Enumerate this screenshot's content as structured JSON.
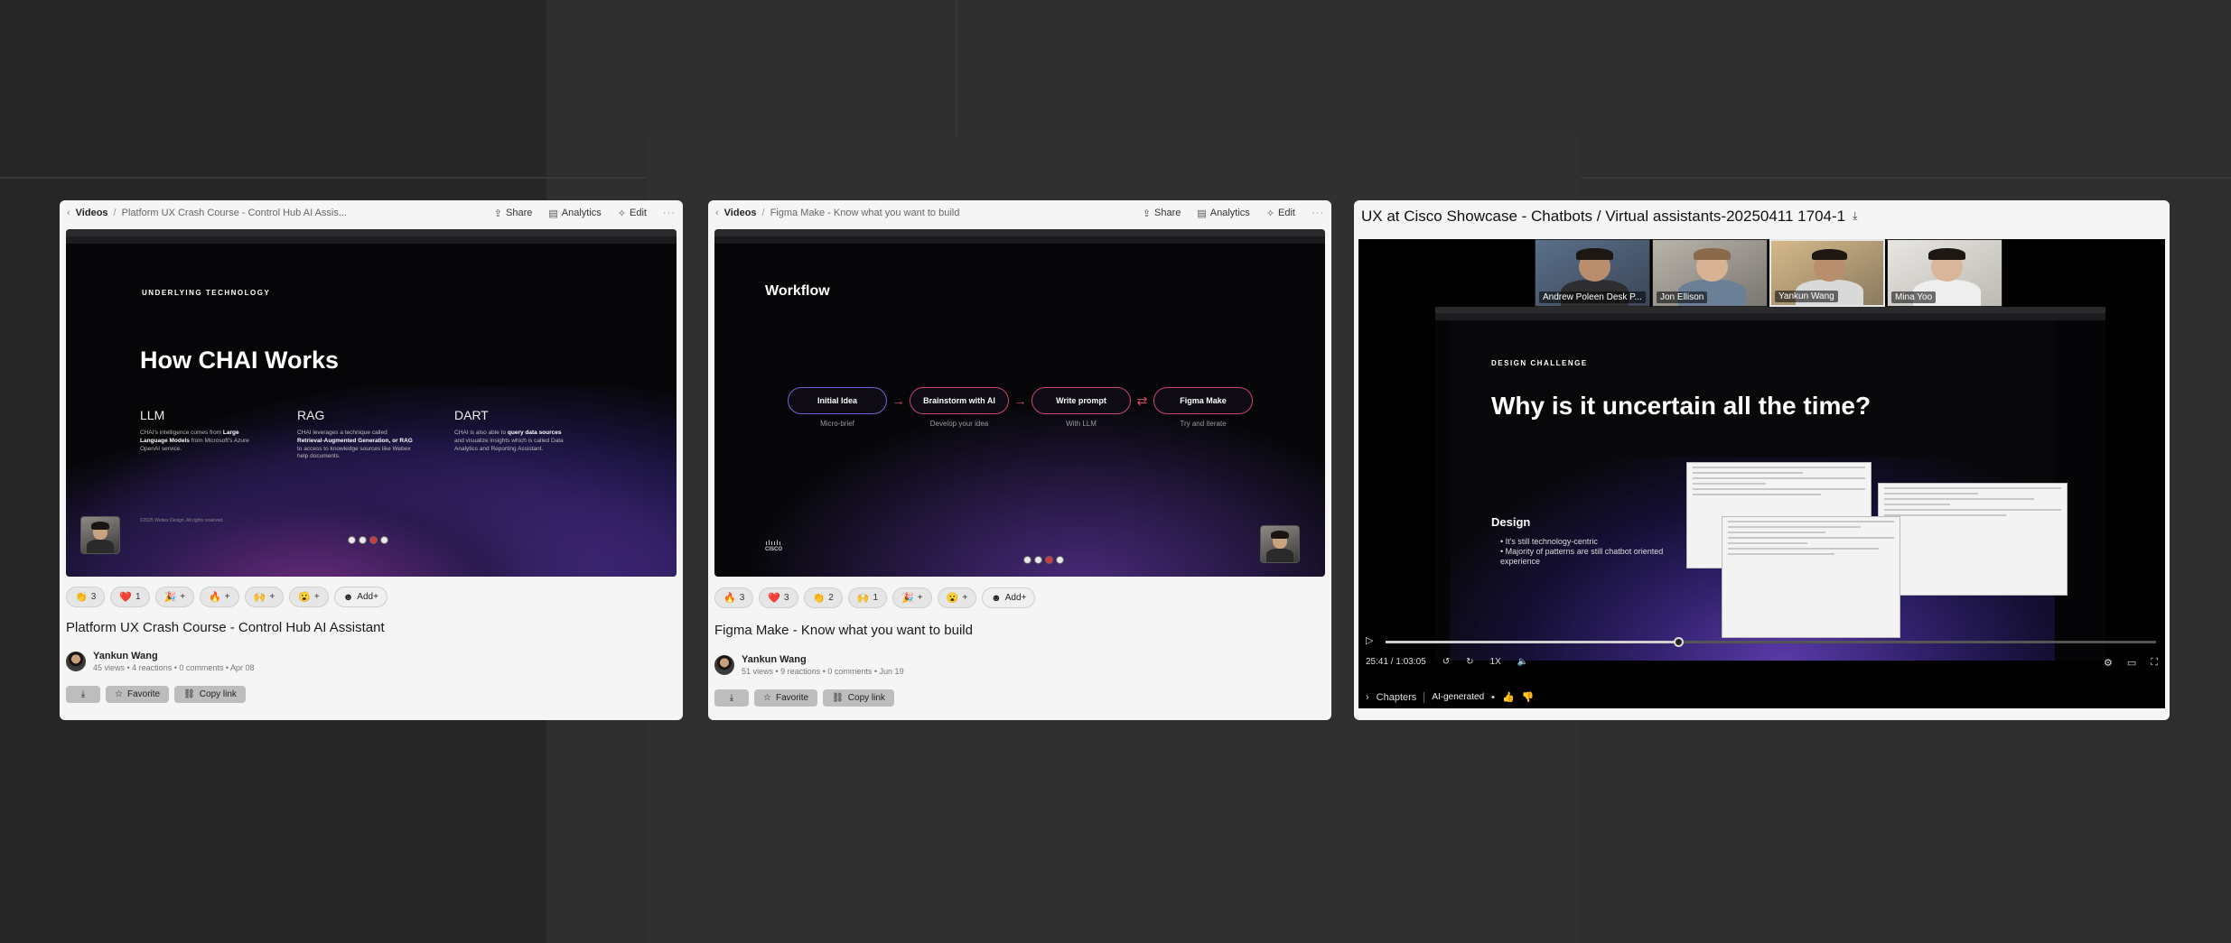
{
  "panels": [
    {
      "breadcrumb_root": "Videos",
      "breadcrumb_sep": "/",
      "breadcrumb_title": "Platform UX Crash Course - Control Hub AI Assis...",
      "share_label": "Share",
      "analytics_label": "Analytics",
      "edit_label": "Edit",
      "more": "···",
      "slide": {
        "kicker": "UNDERLYING TECHNOLOGY",
        "title": "How CHAI Works",
        "copyright": "©2025 Webex Design. All rights reserved."
      },
      "reactions": [
        {
          "emoji": "👏",
          "count": "3"
        },
        {
          "emoji": "❤️",
          "count": "1"
        },
        {
          "emoji": "🎉",
          "count": "+"
        },
        {
          "emoji": "🔥",
          "count": "+"
        },
        {
          "emoji": "🙌",
          "count": "+"
        },
        {
          "emoji": "😮",
          "count": "+"
        }
      ],
      "add_reaction_label": "Add+",
      "title": "Platform UX Crash Course - Control Hub AI Assistant",
      "author_name": "Yankun Wang",
      "views": "45 views",
      "reactions_count": "4 reactions",
      "comments": "0 comments",
      "date": "Apr 08",
      "download_icon": "download-icon",
      "favorite_label": "Favorite",
      "copy_link_label": "Copy link"
    },
    {
      "breadcrumb_root": "Videos",
      "breadcrumb_sep": "/",
      "breadcrumb_title": "Figma Make - Know what you want to build",
      "share_label": "Share",
      "analytics_label": "Analytics",
      "edit_label": "Edit",
      "more": "···",
      "slide": {
        "title": "Workflow",
        "brand": "CISCO"
      },
      "reactions": [
        {
          "emoji": "🔥",
          "count": "3"
        },
        {
          "emoji": "❤️",
          "count": "3"
        },
        {
          "emoji": "👏",
          "count": "2"
        },
        {
          "emoji": "🙌",
          "count": "1"
        },
        {
          "emoji": "🎉",
          "count": "+"
        },
        {
          "emoji": "😮",
          "count": "+"
        }
      ],
      "add_reaction_label": "Add+",
      "title": "Figma Make - Know what you want to build",
      "author_name": "Yankun Wang",
      "views": "51 views",
      "reactions_count": "9 reactions",
      "comments": "0 comments",
      "date": "Jun 19",
      "download_icon": "download-icon",
      "favorite_label": "Favorite",
      "copy_link_label": "Copy link"
    }
  ],
  "chai_columns": [
    {
      "head": "LLM",
      "pre": "CHAI's intelligence comes from ",
      "bold": "Large Language Models",
      "post": " from Microsoft's Azure OpenAI service."
    },
    {
      "head": "RAG",
      "pre": "CHAI leverages a technique called ",
      "bold": "Retrieval-Augmented Generation, or RAG",
      "post": " to access to knowledge sources like Webex help documents."
    },
    {
      "head": "DART",
      "pre": "CHAI is also able to ",
      "bold": "query data sources",
      "post": " and visualize insights which is called Data Analytics and Reporting Assistant."
    }
  ],
  "workflow_steps": [
    {
      "label": "Initial Idea",
      "sub": "Micro-brief"
    },
    {
      "label": "Brainstorm with AI",
      "sub": "Develop your idea"
    },
    {
      "label": "Write prompt",
      "sub": "With LLM"
    },
    {
      "label": "Figma Make",
      "sub": "Try and iterate"
    }
  ],
  "player": {
    "title": "UX at Cisco Showcase - Chatbots / Virtual assistants-20250411 1704-1",
    "participants": [
      "Andrew Poleen Desk P...",
      "Jon Ellison",
      "Yankun Wang",
      "Mina Yoo"
    ],
    "slide_kicker": "DESIGN CHALLENGE",
    "slide_title": "Why is it uncertain all the time?",
    "section_head": "Design",
    "bullets": [
      "It's still technology-centric",
      "Majority of patterns are still chatbot oriented experience"
    ],
    "time": "25:41 / 1:03:05",
    "speed": "1X",
    "progress": 0.38,
    "chapters_label": "Chapters",
    "ai_label": "AI-generated"
  }
}
